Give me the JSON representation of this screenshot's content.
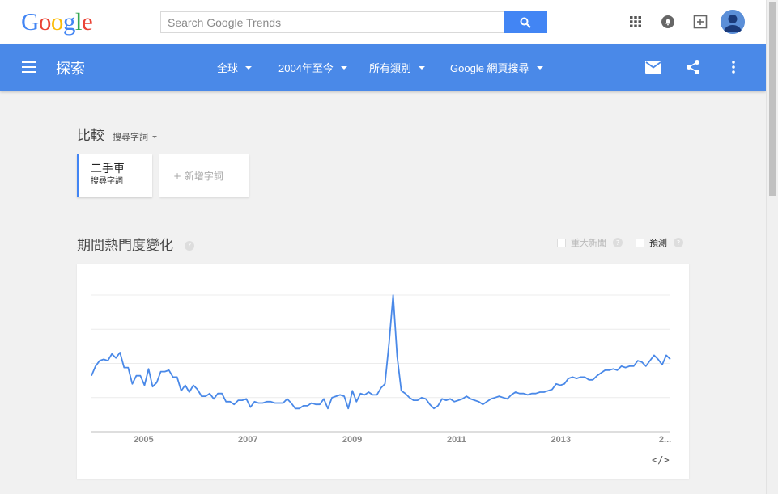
{
  "header": {
    "logo_letters": [
      {
        "ch": "G",
        "color": "#4285f4"
      },
      {
        "ch": "o",
        "color": "#ea4335"
      },
      {
        "ch": "o",
        "color": "#fbbc05"
      },
      {
        "ch": "g",
        "color": "#4285f4"
      },
      {
        "ch": "l",
        "color": "#34a853"
      },
      {
        "ch": "e",
        "color": "#ea4335"
      }
    ],
    "search_placeholder": "Search Google Trends",
    "icons": [
      "apps-grid-icon",
      "notifications-icon",
      "add-box-icon"
    ]
  },
  "toolbar": {
    "title": "探索",
    "filters": [
      {
        "label": "全球"
      },
      {
        "label": "2004年至今"
      },
      {
        "label": "所有類別"
      },
      {
        "label": "Google 網頁搜尋"
      }
    ],
    "right_icons": [
      "email-icon",
      "share-icon",
      "more-vert-icon"
    ]
  },
  "compare": {
    "title": "比較",
    "subtitle": "搜尋字詞",
    "term": {
      "name": "二手車",
      "type": "搜尋字詞"
    },
    "add_label": "+ 新增字詞"
  },
  "interest": {
    "title": "期間熱門度變化",
    "help": "?",
    "toggles": [
      {
        "label": "重大新聞",
        "enabled": false
      },
      {
        "label": "預測",
        "enabled": true
      }
    ]
  },
  "chart_data": {
    "type": "line",
    "series": [
      {
        "color": "#4a89e8",
        "values": [
          41,
          48,
          52,
          53,
          52,
          57,
          54,
          58,
          47,
          47,
          35,
          41,
          41,
          34,
          46,
          33,
          36,
          44,
          44,
          45,
          40,
          40,
          30,
          34,
          29,
          34,
          31,
          26,
          26,
          28,
          24,
          28,
          28,
          22,
          22,
          20,
          23,
          23,
          24,
          18,
          22,
          21,
          21,
          22,
          22,
          21,
          21,
          21,
          24,
          21,
          17,
          17,
          19,
          19,
          21,
          20,
          20,
          24,
          17,
          25,
          26,
          27,
          26,
          17,
          30,
          22,
          28,
          27,
          29,
          27,
          27,
          32,
          35,
          65,
          100,
          55,
          30,
          28,
          25,
          23,
          23,
          25,
          24,
          20,
          17,
          19,
          24,
          23,
          24,
          22,
          23,
          24,
          26,
          24,
          23,
          22,
          20,
          22,
          24,
          25,
          26,
          25,
          24,
          27,
          29,
          28,
          28,
          27,
          28,
          28,
          29,
          29,
          30,
          31,
          35,
          34,
          35,
          39,
          40,
          39,
          40,
          40,
          38,
          38,
          41,
          43,
          45,
          45,
          46,
          45,
          48,
          47,
          48,
          48,
          52,
          51,
          48,
          52,
          56,
          53,
          49,
          56,
          53
        ],
        "display": [
          41,
          48,
          52,
          53,
          52,
          57,
          54,
          58,
          47,
          47,
          35,
          41,
          41,
          34,
          46,
          33,
          36,
          44,
          44,
          45,
          40,
          40,
          30,
          34,
          29,
          34,
          31,
          26,
          26,
          28,
          24,
          28,
          28,
          22,
          22,
          20,
          23,
          23,
          24,
          18,
          22,
          21,
          21,
          22,
          22,
          21,
          21,
          21,
          24,
          21,
          17,
          17,
          19,
          19,
          21,
          20,
          20,
          24,
          17,
          25,
          26,
          27,
          26,
          17,
          30,
          22,
          28,
          27,
          29,
          27,
          27,
          32,
          35,
          65,
          100,
          55,
          30,
          28,
          25,
          23,
          23,
          25,
          24,
          20,
          17,
          19,
          24,
          23,
          24,
          22,
          23,
          24,
          26,
          24,
          23,
          22,
          20,
          22,
          24,
          25,
          26,
          25,
          24,
          27,
          29,
          28,
          28,
          27,
          28,
          28,
          29,
          29,
          30,
          31,
          35,
          34,
          35,
          39,
          40,
          39,
          40,
          40,
          38,
          38,
          41,
          43,
          45,
          45,
          46,
          45,
          48,
          47,
          48,
          48,
          52,
          51,
          48,
          52,
          56,
          53,
          49,
          56,
          53
        ]
      }
    ],
    "x_start": 2004.0,
    "x_end": 2015.1,
    "x_ticks": [
      {
        "value": 2005,
        "label": "2005"
      },
      {
        "value": 2007,
        "label": "2007"
      },
      {
        "value": 2009,
        "label": "2009"
      },
      {
        "value": 2011,
        "label": "2011"
      },
      {
        "value": 2013,
        "label": "2013"
      },
      {
        "value": 2015,
        "label": "2..."
      }
    ],
    "ylim": [
      0,
      100
    ],
    "grid": true,
    "embed_label": "</>"
  }
}
